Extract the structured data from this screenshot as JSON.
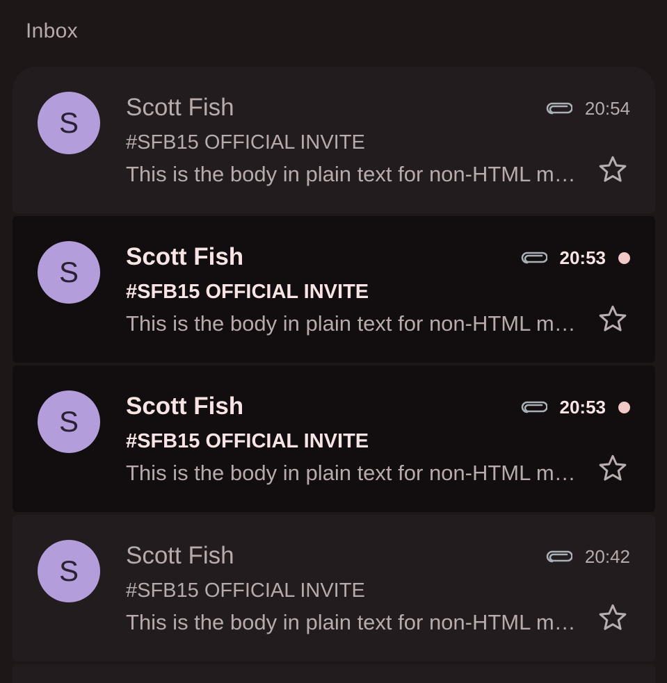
{
  "section_title": "Inbox",
  "colors": {
    "background": "#1d1718",
    "read_item_bg": "#231c1e",
    "unread_item_bg": "#120d0e",
    "avatar_bg": "#b39ddb",
    "unread_dot": "#f2c9c6",
    "read_text": "#b7abac",
    "unread_text": "#f7e4e4"
  },
  "emails": [
    {
      "avatar_letter": "S",
      "sender": "Scott Fish",
      "subject": "#SFB15 OFFICIAL INVITE",
      "snippet": "This is the body in plain text for non-HTML mail clients",
      "time": "20:54",
      "has_attachment": true,
      "unread": false,
      "starred": false
    },
    {
      "avatar_letter": "S",
      "sender": "Scott Fish",
      "subject": "#SFB15 OFFICIAL INVITE",
      "snippet": "This is the body in plain text for non-HTML mail clients",
      "time": "20:53",
      "has_attachment": true,
      "unread": true,
      "starred": false
    },
    {
      "avatar_letter": "S",
      "sender": "Scott Fish",
      "subject": "#SFB15 OFFICIAL INVITE",
      "snippet": "This is the body in plain text for non-HTML mail clients",
      "time": "20:53",
      "has_attachment": true,
      "unread": true,
      "starred": false
    },
    {
      "avatar_letter": "S",
      "sender": "Scott Fish",
      "subject": "#SFB15 OFFICIAL INVITE",
      "snippet": "This is the body in plain text for non-HTML mail clients",
      "time": "20:42",
      "has_attachment": true,
      "unread": false,
      "starred": false
    }
  ],
  "icons": {
    "attachment": "paperclip-icon",
    "star": "star-outline-icon",
    "unread_indicator": "unread-dot"
  }
}
